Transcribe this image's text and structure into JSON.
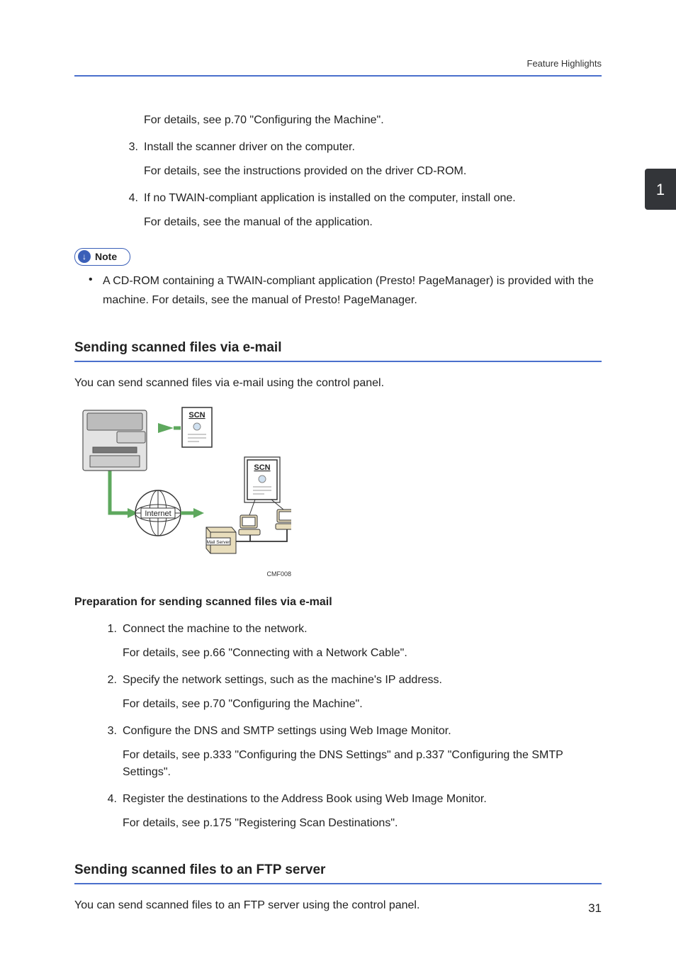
{
  "header": {
    "label": "Feature Highlights"
  },
  "chapter_tab": "1",
  "top_steps": {
    "pre_detail": "For details, see p.70 \"Configuring the Machine\".",
    "items": [
      {
        "num": "3.",
        "text": "Install the scanner driver on the computer.",
        "detail": "For details, see the instructions provided on the driver CD-ROM."
      },
      {
        "num": "4.",
        "text": "If no TWAIN-compliant application is installed on the computer, install one.",
        "detail": "For details, see the manual of the application."
      }
    ]
  },
  "note": {
    "label": "Note",
    "bullet": "A CD-ROM containing a TWAIN-compliant application (Presto! PageManager) is provided with the machine. For details, see the manual of Presto! PageManager."
  },
  "section_email": {
    "heading": "Sending scanned files via e-mail",
    "intro": "You can send scanned files via e-mail using the control panel.",
    "diagram_caption": "CMF008",
    "diagram_labels": {
      "scn": "SCN",
      "internet": "Internet",
      "mail": "Mail Server"
    },
    "prep_heading": "Preparation for sending scanned files via e-mail",
    "steps": [
      {
        "num": "1.",
        "text": "Connect the machine to the network.",
        "detail": "For details, see p.66 \"Connecting with a Network Cable\"."
      },
      {
        "num": "2.",
        "text": "Specify the network settings, such as the machine's IP address.",
        "detail": "For details, see p.70 \"Configuring the Machine\"."
      },
      {
        "num": "3.",
        "text": "Configure the DNS and SMTP settings using Web Image Monitor.",
        "detail": "For details, see p.333 \"Configuring the DNS Settings\" and p.337 \"Configuring the SMTP Settings\"."
      },
      {
        "num": "4.",
        "text": "Register the destinations to the Address Book using Web Image Monitor.",
        "detail": "For details, see p.175 \"Registering Scan Destinations\"."
      }
    ]
  },
  "section_ftp": {
    "heading": "Sending scanned files to an FTP server",
    "intro": "You can send scanned files to an FTP server using the control panel."
  },
  "page_number": "31"
}
